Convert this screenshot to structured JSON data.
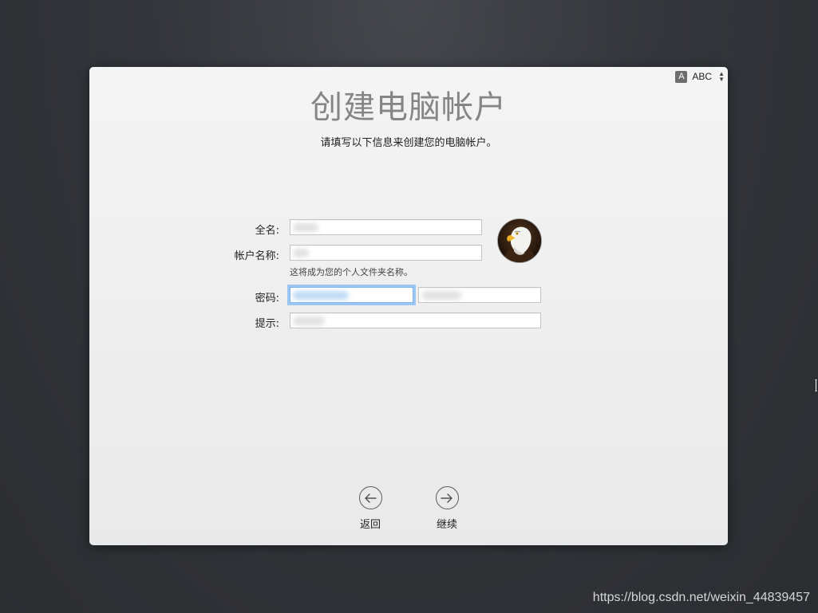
{
  "window": {
    "title": "创建电脑帐户",
    "subtitle": "请填写以下信息来创建您的电脑帐户。"
  },
  "input_source": {
    "badge": "A",
    "label": "ABC",
    "icon": "input-source-icon"
  },
  "form": {
    "full_name_label": "全名:",
    "full_name_value": "",
    "account_name_label": "帐户名称:",
    "account_name_value": "",
    "account_name_note": "这将成为您的个人文件夹名称。",
    "password_label": "密码:",
    "password_value": "",
    "verify_value": "",
    "hint_label": "提示:",
    "hint_value": ""
  },
  "avatar": {
    "icon": "eagle-avatar"
  },
  "buttons": {
    "back_label": "返回",
    "continue_label": "继续"
  },
  "watermark": "https://blog.csdn.net/weixin_44839457"
}
